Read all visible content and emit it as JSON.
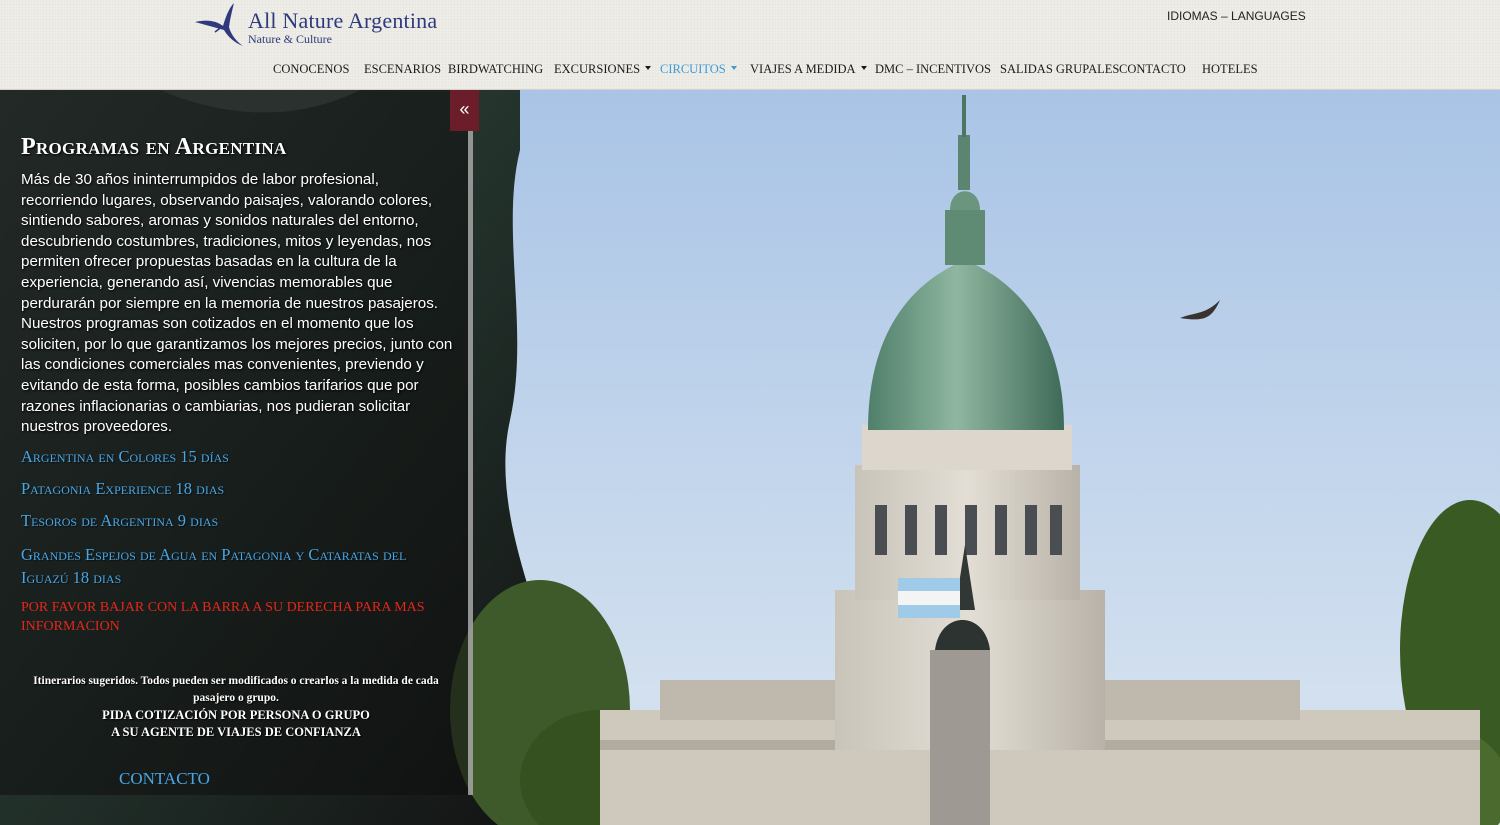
{
  "brand": {
    "title": "All Nature Argentina",
    "subtitle": "Nature & Culture"
  },
  "header": {
    "languages": "IDIOMAS – LANGUAGES"
  },
  "nav": {
    "items": [
      {
        "label": "CONOCENOS"
      },
      {
        "label": "ESCENARIOS"
      },
      {
        "label": "BIRDWATCHING"
      },
      {
        "label": "EXCURSIONES"
      },
      {
        "label": "CIRCUITOS"
      },
      {
        "label": "VIAJES A MEDIDA"
      },
      {
        "label": "DMC – INCENTIVOS"
      },
      {
        "label": "SALIDAS GRUPALES"
      },
      {
        "label": "CONTACTO"
      },
      {
        "label": "HOTELES"
      }
    ]
  },
  "panel": {
    "toggle_icon": "«",
    "title": "Programas en Argentina",
    "description": "Más de 30 años ininterrumpidos de labor profesional, recorriendo lugares, observando paisajes, valorando colores, sintiendo sabores, aromas y sonidos naturales del entorno, descubriendo costumbres, tradiciones, mitos y leyendas, nos permiten ofrecer propuestas basadas en la cultura de la experiencia, generando así, vivencias memorables que perdurarán por siempre en la memoria de nuestros pasajeros. Nuestros programas son cotizados en el momento que los soliciten, por lo que garantizamos los mejores precios, junto con  las condiciones comerciales mas convenientes, previendo y evitando de esta forma, posibles cambios tarifarios que por razones inflacionarias o cambiarias, nos pudieran solicitar nuestros proveedores.",
    "programs": [
      {
        "label": "Argentina en Colores 15 días"
      },
      {
        "label": "Patagonia Experience 18 dias"
      },
      {
        "label": "Tesoros de Argentina 9 dias"
      },
      {
        "label": "Grandes Espejos de Agua en Patagonia y Cataratas del Iguazú 18 dias"
      }
    ],
    "warning": "POR FAVOR BAJAR CON LA BARRA A SU DERECHA PARA MAS INFORMACION",
    "note_line1": "Itinerarios sugeridos. Todos pueden ser modificados o crearlos a la medida de cada pasajero o grupo.",
    "note_line2": "PIDA COTIZACIÓN POR PERSONA O GRUPO",
    "note_line3": "A SU AGENTE DE VIAJES DE CONFIANZA",
    "contact": "CONTACTO"
  },
  "colors": {
    "brand_blue": "#2e3a7c",
    "nav_active": "#3e9ad6",
    "link_blue": "#49a6e5",
    "warning_red": "#e5261a",
    "toggle_bg": "#6b1d2a"
  }
}
